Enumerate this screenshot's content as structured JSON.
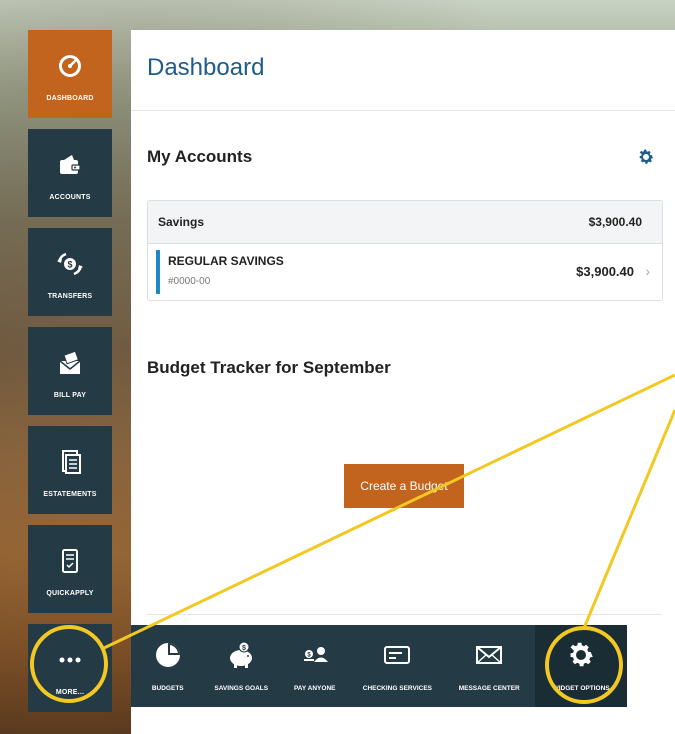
{
  "sidebar": {
    "items": [
      {
        "label": "DASHBOARD",
        "icon": "speedometer-icon",
        "active": true
      },
      {
        "label": "ACCOUNTS",
        "icon": "wallet-icon"
      },
      {
        "label": "TRANSFERS",
        "icon": "transfer-icon"
      },
      {
        "label": "BILL PAY",
        "icon": "envelope-bill-icon"
      },
      {
        "label": "ESTATEMENTS",
        "icon": "document-icon"
      },
      {
        "label": "QUICKAPPLY",
        "icon": "tablet-check-icon"
      },
      {
        "label": "MORE...",
        "icon": "more-dots-icon"
      }
    ]
  },
  "main": {
    "title": "Dashboard",
    "accounts": {
      "title": "My Accounts",
      "group": {
        "name": "Savings",
        "total": "$3,900.40"
      },
      "rows": [
        {
          "name": "REGULAR SAVINGS",
          "number": "#0000-00",
          "balance": "$3,900.40"
        }
      ]
    },
    "budget": {
      "title": "Budget Tracker for September",
      "button": "Create a Budget"
    }
  },
  "toolbar": {
    "items": [
      {
        "label": "BUDGETS",
        "icon": "pie-chart-icon"
      },
      {
        "label": "SAVINGS GOALS",
        "icon": "piggy-bank-icon"
      },
      {
        "label": "PAY ANYONE",
        "icon": "pay-person-icon"
      },
      {
        "label": "CHECKING SERVICES",
        "icon": "check-card-icon"
      },
      {
        "label": "MESSAGE CENTER",
        "icon": "mail-icon"
      },
      {
        "label": "WIDGET OPTIONS",
        "icon": "gear-icon"
      }
    ]
  },
  "colors": {
    "accent": "#c2641e",
    "nav": "#243a44",
    "title": "#1f5c8a",
    "highlight": "#f2c823"
  }
}
